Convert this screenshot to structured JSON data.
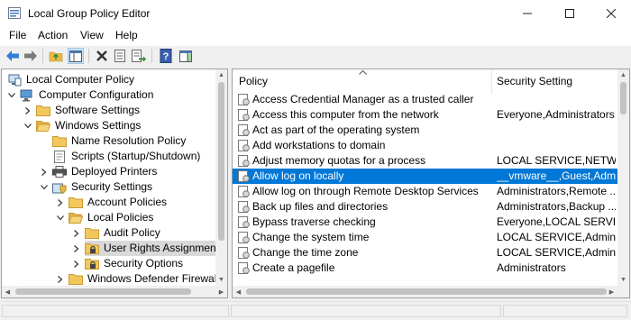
{
  "window": {
    "title": "Local Group Policy Editor",
    "controls": [
      "minimize-icon",
      "maximize-icon",
      "close-icon"
    ]
  },
  "menu": {
    "items": [
      "File",
      "Action",
      "View",
      "Help"
    ]
  },
  "toolbar": {
    "buttons": [
      "back-arrow-icon",
      "forward-arrow-icon",
      "up-folder-icon",
      "show-hide-console-tree-icon",
      "delete-icon",
      "properties-icon",
      "export-list-icon",
      "help-icon",
      "show-action-pane-icon"
    ]
  },
  "tree": {
    "nodes": [
      {
        "label": "Local Computer Policy",
        "icon": "policy-computer-icon"
      },
      {
        "label": "Computer Configuration",
        "icon": "computer-icon",
        "expanded": true
      },
      {
        "label": "Software Settings",
        "icon": "folder-icon"
      },
      {
        "label": "Windows Settings",
        "icon": "folder-icon",
        "expanded": true
      },
      {
        "label": "Name Resolution Policy",
        "icon": "folder-icon"
      },
      {
        "label": "Scripts (Startup/Shutdown)",
        "icon": "script-icon"
      },
      {
        "label": "Deployed Printers",
        "icon": "printer-icon"
      },
      {
        "label": "Security Settings",
        "icon": "security-icon",
        "expanded": true
      },
      {
        "label": "Account Policies",
        "icon": "folder-icon"
      },
      {
        "label": "Local Policies",
        "icon": "folder-icon",
        "expanded": true
      },
      {
        "label": "Audit Policy",
        "icon": "folder-icon"
      },
      {
        "label": "User Rights Assignment",
        "icon": "folder-lock-icon",
        "selected": true
      },
      {
        "label": "Security Options",
        "icon": "folder-lock-icon"
      },
      {
        "label": "Windows Defender Firewall w",
        "icon": "folder-icon"
      }
    ]
  },
  "list": {
    "columns": [
      "Policy",
      "Security Setting"
    ],
    "rows": [
      {
        "policy": "Access Credential Manager as a trusted caller",
        "setting": ""
      },
      {
        "policy": "Access this computer from the network",
        "setting": "Everyone,Administrators..."
      },
      {
        "policy": "Act as part of the operating system",
        "setting": ""
      },
      {
        "policy": "Add workstations to domain",
        "setting": ""
      },
      {
        "policy": "Adjust memory quotas for a process",
        "setting": "LOCAL SERVICE,NETWO..."
      },
      {
        "policy": "Allow log on locally",
        "setting": "__vmware__,Guest,Admi...",
        "selected": true
      },
      {
        "policy": "Allow log on through Remote Desktop Services",
        "setting": "Administrators,Remote ..."
      },
      {
        "policy": "Back up files and directories",
        "setting": "Administrators,Backup ..."
      },
      {
        "policy": "Bypass traverse checking",
        "setting": "Everyone,LOCAL SERVIC..."
      },
      {
        "policy": "Change the system time",
        "setting": "LOCAL SERVICE,Admini..."
      },
      {
        "policy": "Change the time zone",
        "setting": "LOCAL SERVICE,Admini..."
      },
      {
        "policy": "Create a pagefile",
        "setting": "Administrators"
      }
    ]
  },
  "colors": {
    "selection": "#0078d7",
    "tree_selection": "#d9d9d9",
    "folder": "#e8b94a"
  }
}
